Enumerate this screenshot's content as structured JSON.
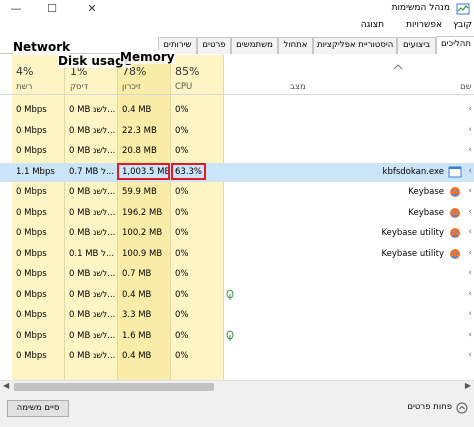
{
  "window": {
    "title": "מנהל המשימות",
    "minimize": "—",
    "maximize": "☐",
    "close": "✕"
  },
  "menu": [
    "קובץ",
    "אפשרויות",
    "תצוגה"
  ],
  "tabs": [
    {
      "label": "תהליכים",
      "active": true
    },
    {
      "label": "ביצועים"
    },
    {
      "label": "היסטוריית אפליקציות"
    },
    {
      "label": "אתחול"
    },
    {
      "label": "משתמשים"
    },
    {
      "label": "פרטים"
    },
    {
      "label": "שירותים"
    }
  ],
  "columns": {
    "name": "שם",
    "status": "מצב",
    "cpu": {
      "pct": "85%",
      "label": "CPU"
    },
    "memory": {
      "pct": "78%",
      "label": "זיכרון"
    },
    "disk": {
      "pct": "1%",
      "label": "דיסק"
    },
    "network": {
      "pct": "4%",
      "label": "רשת"
    }
  },
  "rows": [
    {
      "name": "",
      "cpu": "0%",
      "memory": "0.4 MB",
      "disk": "0 MB לשנ...",
      "network": "0 Mbps"
    },
    {
      "name": "",
      "cpu": "0%",
      "memory": "22.3 MB",
      "disk": "0 MB לשנ...",
      "network": "0 Mbps"
    },
    {
      "name": "",
      "cpu": "0%",
      "memory": "20.8 MB",
      "disk": "0 MB לשנ...",
      "network": "0 Mbps"
    },
    {
      "name": "kbfsdokan.exe",
      "cpu": "63.3%",
      "memory": "1,003.5 MB",
      "disk": "0.7 MB ל...",
      "network": "1.1 Mbps",
      "selected": true,
      "icon": "app-window-icon"
    },
    {
      "name": "Keybase",
      "cpu": "0%",
      "memory": "59.9 MB",
      "disk": "0 MB לשנ...",
      "network": "0 Mbps",
      "icon": "keybase-icon"
    },
    {
      "name": "Keybase",
      "cpu": "0%",
      "memory": "196.2 MB",
      "disk": "0 MB לשנ...",
      "network": "0 Mbps",
      "icon": "keybase-icon"
    },
    {
      "name": "Keybase utility",
      "cpu": "0%",
      "memory": "100.2 MB",
      "disk": "0 MB לשנ...",
      "network": "0 Mbps",
      "icon": "keybase-icon"
    },
    {
      "name": "Keybase utility",
      "cpu": "0%",
      "memory": "100.9 MB",
      "disk": "0.1 MB ל...",
      "network": "0 Mbps",
      "icon": "keybase-icon"
    },
    {
      "name": "",
      "cpu": "0%",
      "memory": "0.7 MB",
      "disk": "0 MB לשנ...",
      "network": "0 Mbps"
    },
    {
      "name": "",
      "cpu": "0%",
      "memory": "0.4 MB",
      "disk": "0 MB לשנ...",
      "network": "0 Mbps",
      "status_icon": "leaf-icon"
    },
    {
      "name": "",
      "cpu": "0%",
      "memory": "3.3 MB",
      "disk": "0 MB לשנ...",
      "network": "0 Mbps"
    },
    {
      "name": "",
      "cpu": "0%",
      "memory": "1.6 MB",
      "disk": "0 MB לשנ...",
      "network": "0 Mbps",
      "status_icon": "leaf-icon"
    },
    {
      "name": "",
      "cpu": "0%",
      "memory": "0.4 MB",
      "disk": "0 MB לשנ...",
      "network": "0 Mbps"
    }
  ],
  "annotations": {
    "network": "Network",
    "disk": "Disk usage",
    "memory": "Memory"
  },
  "footer": {
    "end_task": "סיים משימה",
    "fewer_details": "פחות פרטים"
  },
  "colors": {
    "heat_light": "#fff4c4",
    "heat_medium": "#f9eca8",
    "selected_row": "#cce4f7",
    "highlight": "#e01b24"
  }
}
